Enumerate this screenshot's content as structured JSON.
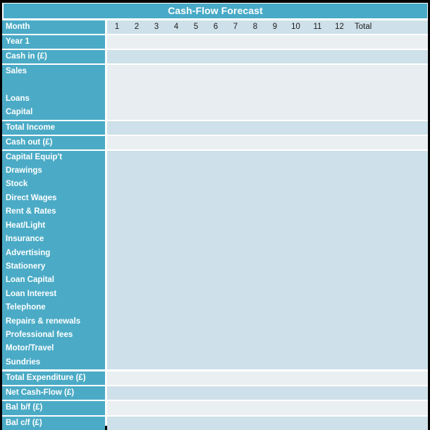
{
  "title": "Cash-Flow Forecast",
  "header": {
    "row_label": "Month",
    "months": [
      "1",
      "2",
      "3",
      "4",
      "5",
      "6",
      "7",
      "8",
      "9",
      "10",
      "11",
      "12"
    ],
    "total_label": "Total"
  },
  "colors": {
    "title_bar": "#48AAC7",
    "label_cell": "#4BABC6",
    "data_blue": "#CEE0E9",
    "data_pale": "#EAEFF2",
    "income_block": "#E7EDF0",
    "text_on_teal": "#FFFFFF",
    "frame": "#000000"
  },
  "rows": {
    "year": {
      "label": "Year 1",
      "fill": "pale"
    },
    "cash_in": {
      "label": "Cash in (£)",
      "fill": "blue"
    },
    "income_items": [
      {
        "label": "Sales"
      },
      {
        "label": ""
      },
      {
        "label": "Loans"
      },
      {
        "label": "Capital"
      }
    ],
    "total_income": {
      "label": "Total Income",
      "fill": "blue"
    },
    "cash_out": {
      "label": "Cash out (£)",
      "fill": "pale"
    },
    "expenditure_items": [
      {
        "label": "Capital Equip't"
      },
      {
        "label": "Drawings"
      },
      {
        "label": "Stock"
      },
      {
        "label": "Direct Wages"
      },
      {
        "label": "Rent & Rates"
      },
      {
        "label": "Heat/Light"
      },
      {
        "label": "Insurance"
      },
      {
        "label": "Advertising"
      },
      {
        "label": "Stationery"
      },
      {
        "label": "Loan Capital"
      },
      {
        "label": "Loan Interest"
      },
      {
        "label": "Telephone"
      },
      {
        "label": "Repairs & renewals"
      },
      {
        "label": "Professional fees"
      },
      {
        "label": "Motor/Travel"
      },
      {
        "label": "Sundries"
      }
    ],
    "summary": [
      {
        "label": "Total Expenditure (£)",
        "fill": "pale"
      },
      {
        "label": "Net Cash-Flow (£)",
        "fill": "blue"
      },
      {
        "label": "Bal b/f (£)",
        "fill": "pale"
      },
      {
        "label": "Bal c/f (£)",
        "fill": "blue"
      }
    ]
  }
}
